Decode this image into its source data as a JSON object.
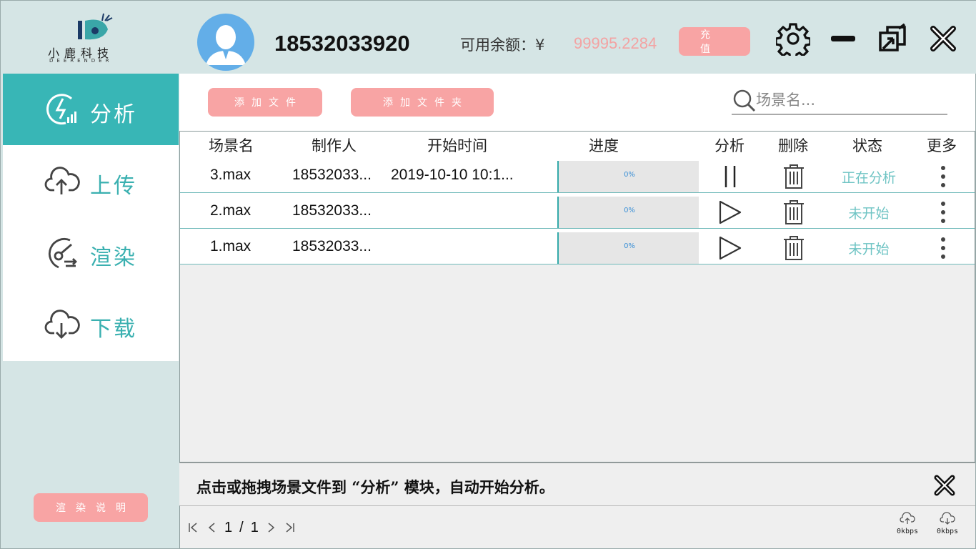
{
  "header": {
    "logo_text": "小鹿科技",
    "logo_sub": "DEERENDER",
    "phone": "18532033920",
    "balance_label": "可用余额：¥",
    "balance_value": "99995.2284",
    "recharge_label": "充值",
    "window_icons": [
      "gear-icon",
      "minimize-icon",
      "restore-icon",
      "close-icon"
    ]
  },
  "sidebar": {
    "items": [
      {
        "label": "分析",
        "icon": "analyze-icon",
        "active": true
      },
      {
        "label": "上传",
        "icon": "upload-cloud-icon",
        "active": false
      },
      {
        "label": "渲染",
        "icon": "render-icon",
        "active": false
      },
      {
        "label": "下载",
        "icon": "download-cloud-icon",
        "active": false
      }
    ],
    "help_label": "渲染说明"
  },
  "toolbar": {
    "add_file_label": "添加文件",
    "add_folder_label": "添加文件夹",
    "search_placeholder": "场景名..."
  },
  "table": {
    "columns": [
      "场景名",
      "制作人",
      "开始时间",
      "进度",
      "分析",
      "删除",
      "状态",
      "更多"
    ],
    "rows": [
      {
        "name": "3.max",
        "maker": "18532033...",
        "start": "2019-10-10 10:1...",
        "progress": 0,
        "progress_label": "0%",
        "action": "pause-icon",
        "status": "正在分析"
      },
      {
        "name": "2.max",
        "maker": "18532033...",
        "start": "",
        "progress": 0,
        "progress_label": "0%",
        "action": "play-icon",
        "status": "未开始"
      },
      {
        "name": "1.max",
        "maker": "18532033...",
        "start": "",
        "progress": 0,
        "progress_label": "0%",
        "action": "play-icon",
        "status": "未开始"
      }
    ]
  },
  "notice": {
    "text": "点击或拖拽场景文件到 “分析” 模块，自动开始分析。"
  },
  "footer": {
    "current_page": "1",
    "separator": "/",
    "total_pages": "1",
    "upload_speed": "0kbps",
    "download_speed": "0kbps"
  },
  "colors": {
    "accent": "#38b6b6",
    "pink": "#f8a4a4",
    "background": "#d5e5e5"
  }
}
